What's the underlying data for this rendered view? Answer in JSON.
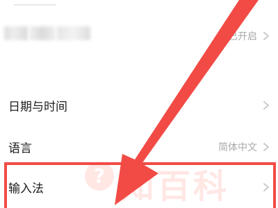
{
  "settings": {
    "notification_row": {
      "value": "已开启",
      "icon": "chevron-right-icon"
    },
    "date_time_row": {
      "label": "日期与时间",
      "icon": "chevron-right-icon"
    },
    "language_row": {
      "label": "语言",
      "value": "简体中文",
      "icon": "chevron-right-icon"
    },
    "input_method_row": {
      "label": "输入法",
      "icon": "chevron-right-icon"
    }
  },
  "watermark": {
    "text": "知百科",
    "badge": "?"
  },
  "colors": {
    "highlight": "#f24b46",
    "label_text": "#1d1d1d",
    "value_text": "#a9a9a9",
    "chevron": "#c7c7c7",
    "watermark": "#ff6e5c"
  }
}
